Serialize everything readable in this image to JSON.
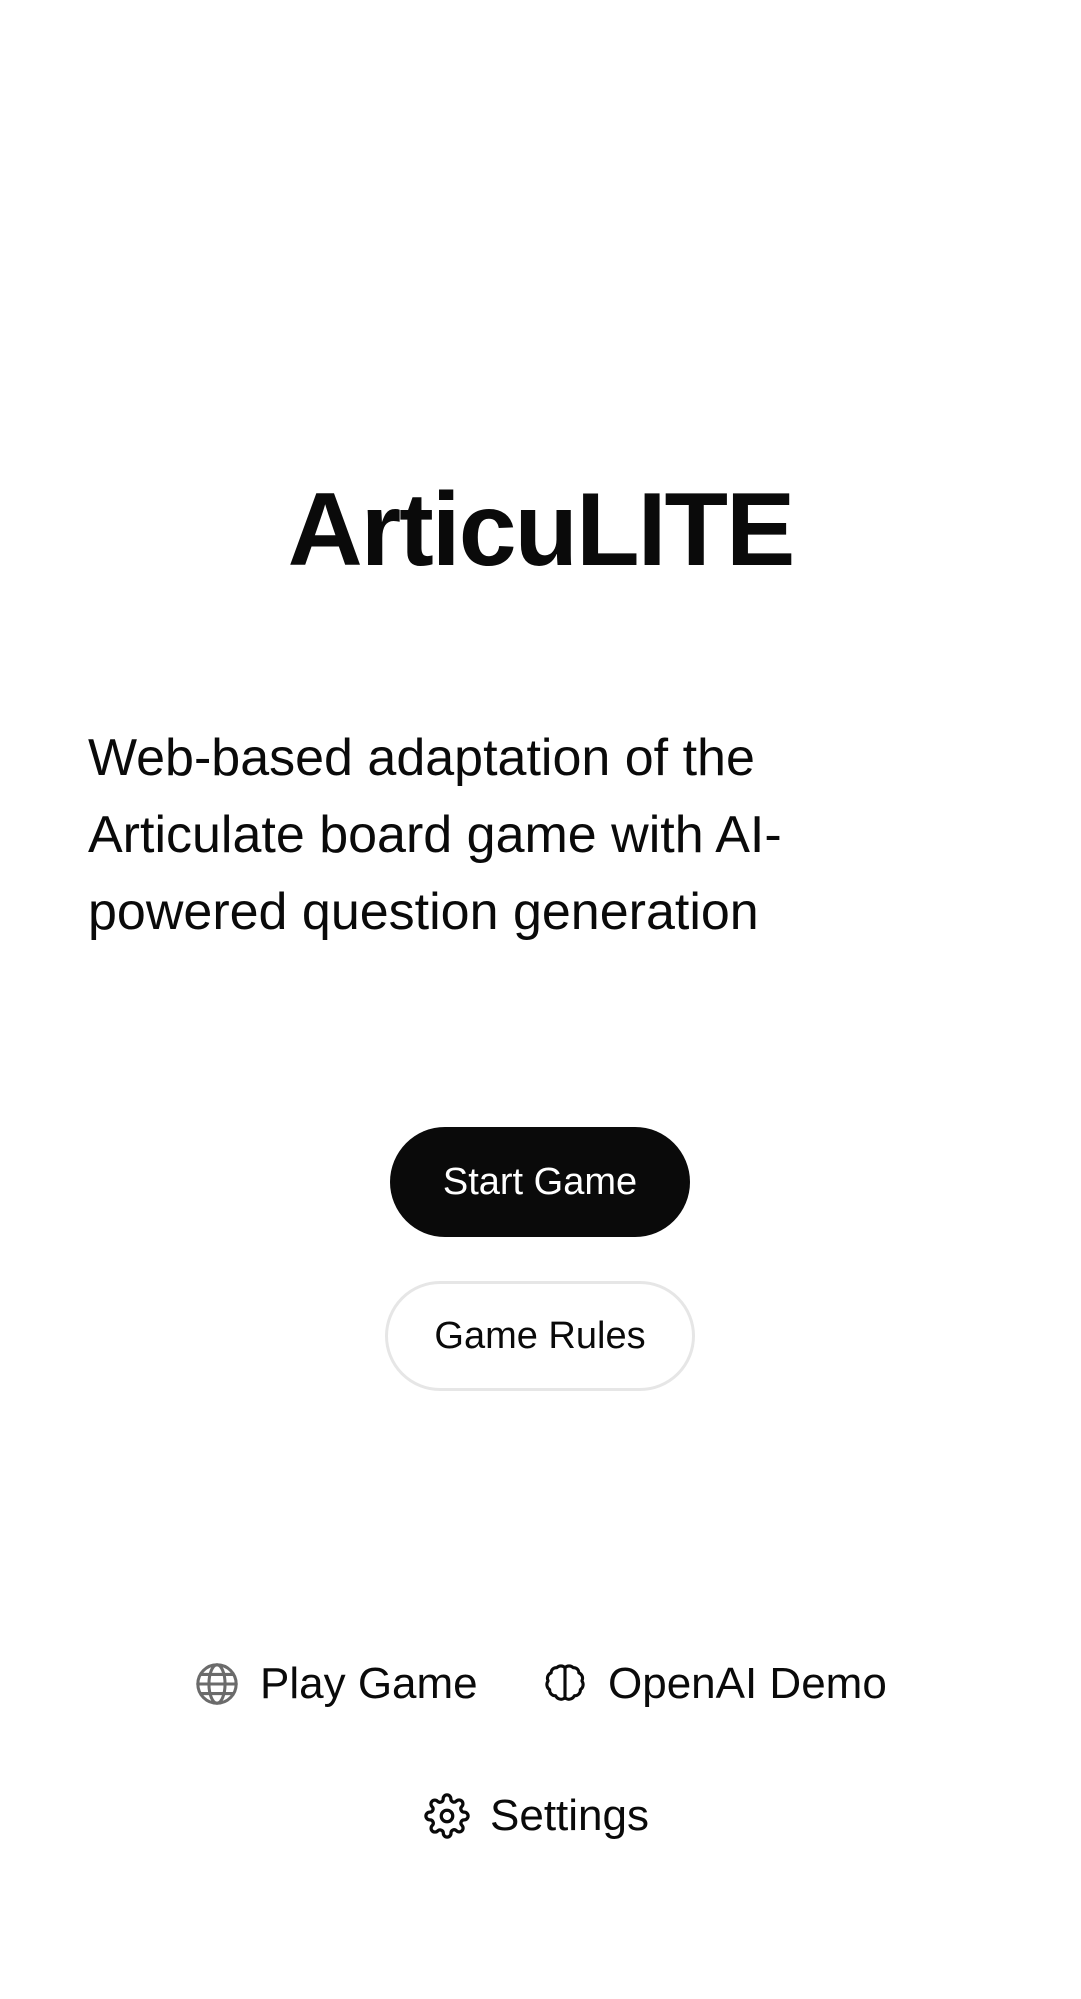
{
  "app": {
    "title": "ArticuLITE",
    "description": "Web-based adaptation of the Articulate board game with AI-powered question generation"
  },
  "actions": {
    "start_label": "Start Game",
    "rules_label": "Game Rules"
  },
  "footer_nav": {
    "items": [
      {
        "label": "Play Game",
        "icon": "globe-icon"
      },
      {
        "label": "OpenAI Demo",
        "icon": "brain-icon"
      },
      {
        "label": "Settings",
        "icon": "gear-icon"
      }
    ]
  },
  "colors": {
    "primary": "#0a0a0a",
    "background": "#ffffff",
    "border": "#e6e6e6",
    "icon_muted": "#6b6b6b"
  }
}
